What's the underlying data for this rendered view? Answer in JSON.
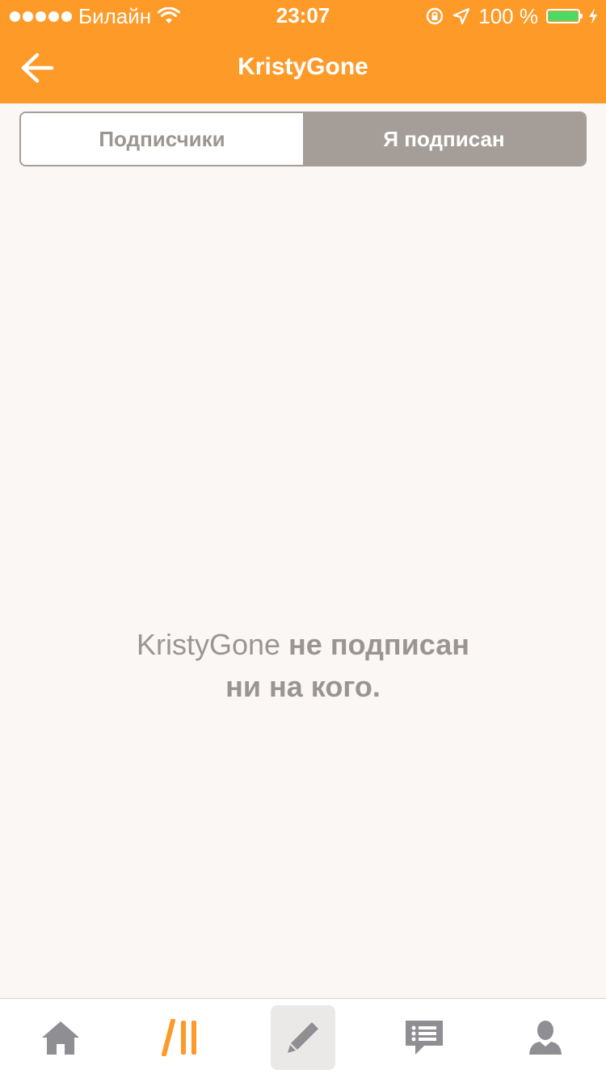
{
  "status_bar": {
    "carrier": "Билайн",
    "time": "23:07",
    "battery": "100 %",
    "battery_level": 1.0
  },
  "nav": {
    "title": "KristyGone"
  },
  "segments": {
    "followers_label": "Подписчики",
    "following_label": "Я подписан",
    "active": "following"
  },
  "empty_state": {
    "username": "KristyGone",
    "line1_rest": " не подписан",
    "line2": "ни на кого."
  },
  "tabbar": {
    "items": [
      {
        "icon": "home-icon"
      },
      {
        "icon": "feed-icon"
      },
      {
        "icon": "pencil-icon"
      },
      {
        "icon": "messages-icon"
      },
      {
        "icon": "profile-icon"
      }
    ]
  },
  "colors": {
    "accent": "#fe9a28",
    "segment_active": "#a59d98",
    "background": "#faf7f4",
    "icon_gray": "#8e8e93",
    "battery_green": "#4cd964"
  }
}
